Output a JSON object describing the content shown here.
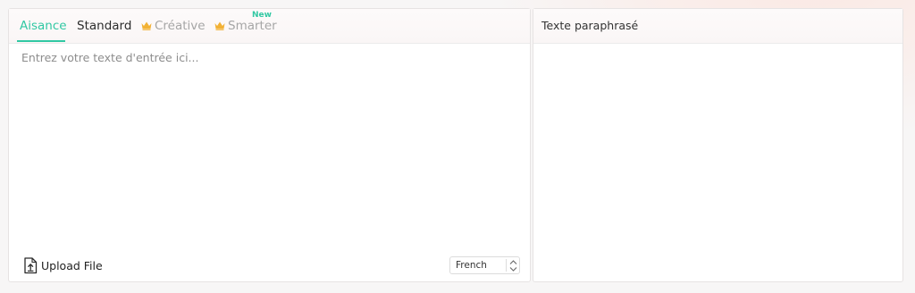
{
  "tabs": [
    {
      "label": "Aisance",
      "state": "active"
    },
    {
      "label": "Standard",
      "state": "normal"
    },
    {
      "label": "Créative",
      "state": "premium",
      "icon": "crown-icon"
    },
    {
      "label": "Smarter",
      "state": "premium",
      "icon": "crown-icon",
      "badge": "New"
    }
  ],
  "input": {
    "placeholder": "Entrez votre texte d'entrée ici..."
  },
  "upload": {
    "label": "Upload File",
    "icon": "upload-file-icon"
  },
  "language": {
    "selected": "French"
  },
  "output": {
    "title": "Texte paraphrasé"
  },
  "colors": {
    "accent": "#31c8a3",
    "crown": "#f2b134"
  }
}
